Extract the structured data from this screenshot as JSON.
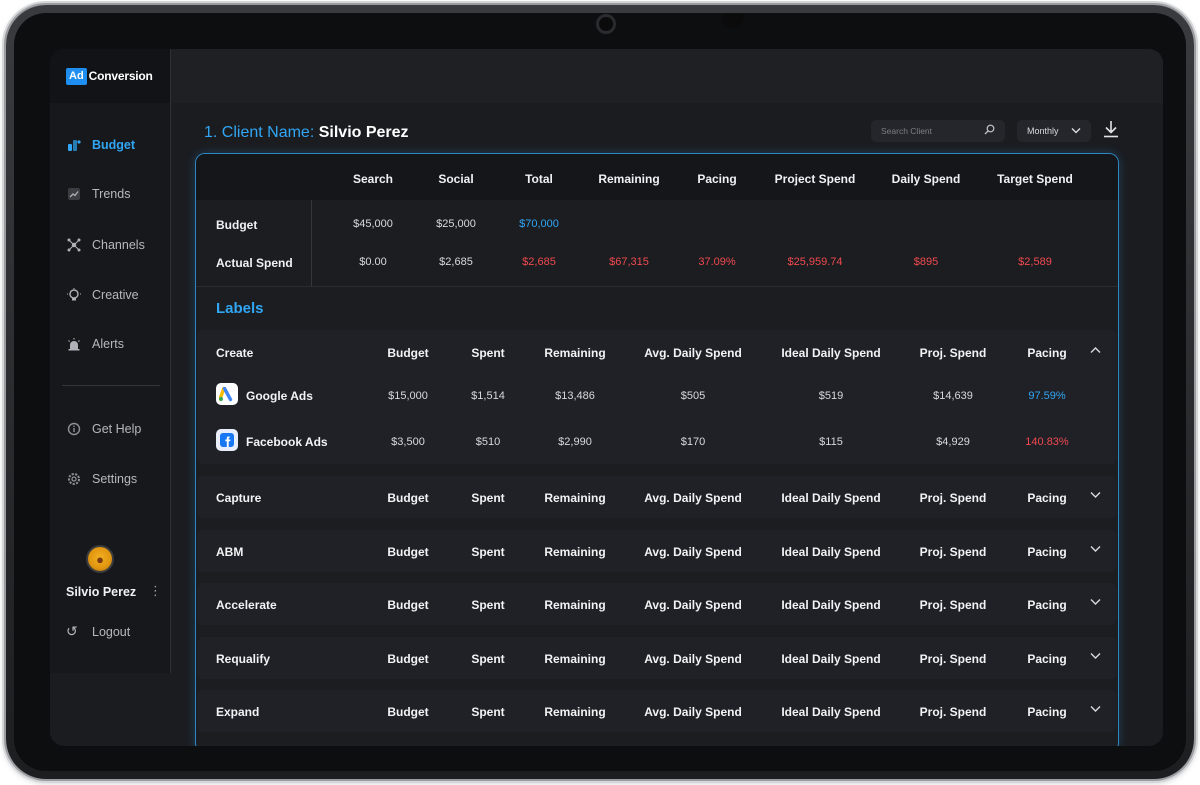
{
  "brand": {
    "badge": "Ad",
    "name": "Conversion"
  },
  "sidebar": {
    "items": [
      {
        "label": "Budget",
        "icon": "coins-icon",
        "active": true
      },
      {
        "label": "Trends",
        "icon": "trend-chart-icon",
        "active": false
      },
      {
        "label": "Channels",
        "icon": "network-icon",
        "active": false
      },
      {
        "label": "Creative",
        "icon": "lightbulb-icon",
        "active": false
      },
      {
        "label": "Alerts",
        "icon": "siren-icon",
        "active": false
      },
      {
        "label": "Get Help",
        "icon": "info-icon",
        "active": false
      },
      {
        "label": "Settings",
        "icon": "gear-icon",
        "active": false
      }
    ],
    "user": {
      "name": "Silvio Perez"
    },
    "logout_label": "Logout"
  },
  "header": {
    "title_number": "1.",
    "title_label": "Client Name:",
    "title_value": "Silvio Perez",
    "search_placeholder": "Search Client",
    "period": "Monthly"
  },
  "summary": {
    "columns": [
      "Search",
      "Social",
      "Total",
      "Remaining",
      "Pacing",
      "Project Spend",
      "Daily Spend",
      "Target Spend"
    ],
    "rows": [
      {
        "label": "Budget",
        "values": [
          "$45,000",
          "$25,000",
          "$70,000",
          "",
          "",
          "",
          "",
          ""
        ]
      },
      {
        "label": "Actual Spend",
        "values": [
          "$0.00",
          "$2,685",
          "$2,685",
          "$67,315",
          "37.09%",
          "$25,959.74",
          "$895",
          "$2,589"
        ]
      }
    ]
  },
  "labels_title": "Labels",
  "group_columns": [
    "Budget",
    "Spent",
    "Remaining",
    "Avg. Daily Spend",
    "Ideal Daily Spend",
    "Proj. Spend",
    "Pacing"
  ],
  "groups": [
    {
      "name": "Create",
      "expanded": true
    },
    {
      "name": "Capture",
      "expanded": false
    },
    {
      "name": "ABM",
      "expanded": false
    },
    {
      "name": "Accelerate",
      "expanded": false
    },
    {
      "name": "Requalify",
      "expanded": false
    },
    {
      "name": "Expand",
      "expanded": false
    }
  ],
  "create_sources": [
    {
      "name": "Google Ads",
      "icon": "google-ads-icon",
      "values": [
        "$15,000",
        "$1,514",
        "$13,486",
        "$505",
        "$519",
        "$14,639",
        "97.59%"
      ]
    },
    {
      "name": "Facebook Ads",
      "icon": "facebook-icon",
      "values": [
        "$3,500",
        "$510",
        "$2,990",
        "$170",
        "$115",
        "$4,929",
        "140.83%"
      ]
    }
  ],
  "colors": {
    "accent": "#31a6f5",
    "alert": "#f0494f"
  }
}
